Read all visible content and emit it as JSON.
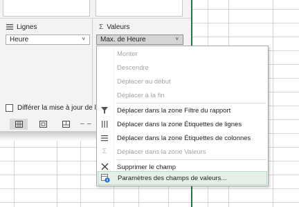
{
  "pivot_pane": {
    "rows_area": {
      "icon": "rows-lines-icon",
      "label": "Lignes",
      "field_value": "Heure"
    },
    "values_area": {
      "icon": "sigma-icon",
      "label": "Valeurs",
      "field_value": "Max. de Heure"
    },
    "defer_update_label": "Différer la mise à jour de l",
    "chevron_glyph": "˅"
  },
  "context_menu": {
    "items": [
      {
        "label": "Monter",
        "enabled": false,
        "icon": ""
      },
      {
        "label": "Descendre",
        "enabled": false,
        "icon": ""
      },
      {
        "label": "Déplacer au début",
        "enabled": false,
        "icon": ""
      },
      {
        "label": "Déplacer à la fin",
        "enabled": false,
        "icon": ""
      },
      {
        "label": "Déplacer dans la zone Filtre du rapport",
        "enabled": true,
        "icon": "filter-icon"
      },
      {
        "label": "Déplacer dans la zone Étiquettes de lignes",
        "enabled": true,
        "icon": "row-labels-icon"
      },
      {
        "label": "Déplacer dans la zone Étiquettes de colonnes",
        "enabled": true,
        "icon": "column-labels-icon"
      },
      {
        "label": "Déplacer dans la zone Valeurs",
        "enabled": false,
        "icon": "sigma-icon"
      },
      {
        "label": "Supprimer le champ",
        "enabled": true,
        "icon": "remove-field-icon"
      },
      {
        "label": "Paramètres des champs de valeurs...",
        "enabled": true,
        "highlighted": true,
        "icon": "field-settings-icon"
      }
    ]
  },
  "colors": {
    "accent": "#217346",
    "highlight": "#e5f1e8",
    "disabled_text": "#a3a3a3"
  }
}
